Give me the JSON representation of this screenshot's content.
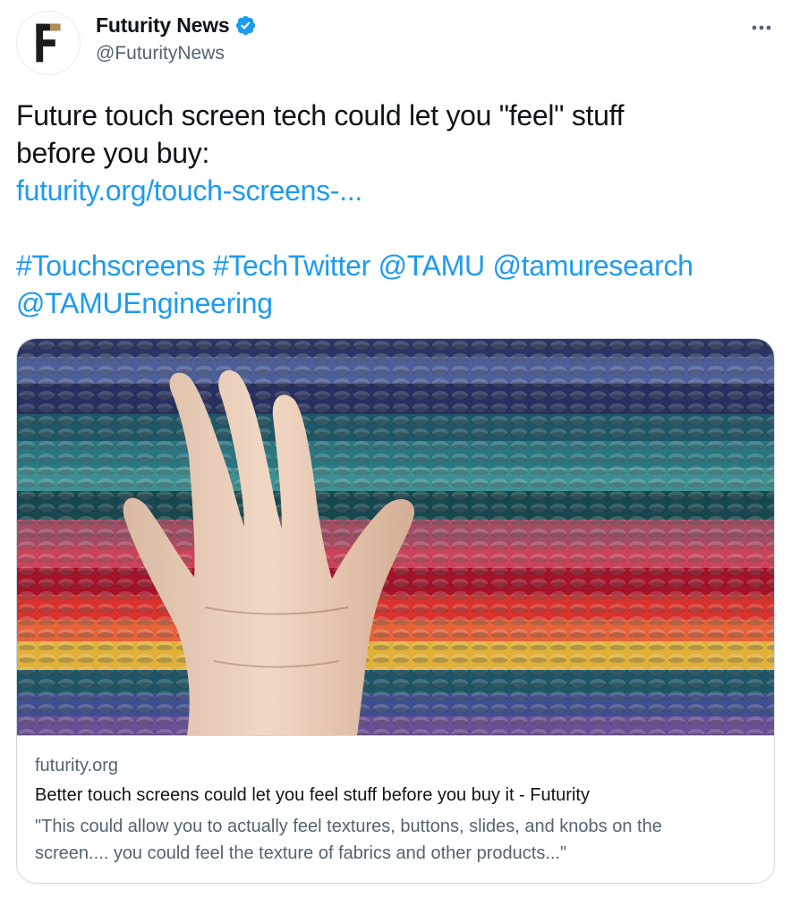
{
  "author": {
    "display_name": "Futurity News",
    "handle": "@FuturityNews",
    "avatar_letter": "F",
    "verified": true
  },
  "tweet": {
    "text_line1": "Future touch screen tech could let you \"feel\" stuff",
    "text_line2": "before you buy:",
    "link": "futurity.org/touch-screens-...",
    "hashtag_1": "#Touchscreens",
    "hashtag_2": "#TechTwitter",
    "mention_1": "@TAMU",
    "mention_2": "@tamuresearch",
    "mention_3": "@TAMUEngineering"
  },
  "card": {
    "domain": "futurity.org",
    "title": "Better touch screens could let you feel stuff before you buy it - Futurity",
    "description_line1": "\"This could allow you to actually feel textures, buttons, slides, and knobs on the",
    "description_line2": "screen.... you could feel the texture of fabrics and other products...\""
  },
  "icons": {
    "more": "more-horizontal-icon",
    "verified": "verified-badge-icon"
  },
  "colors": {
    "link": "#1d9bf0",
    "text": "#0f1419",
    "secondary": "#536471",
    "border": "#cfd9de"
  }
}
